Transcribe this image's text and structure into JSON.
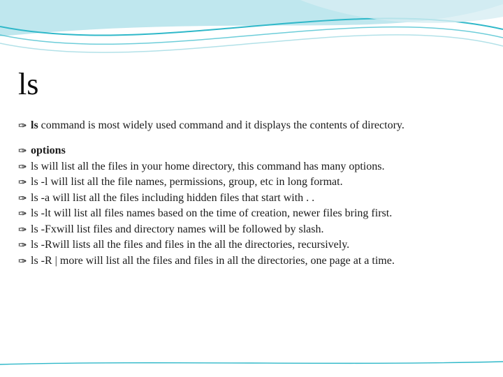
{
  "title": "ls",
  "intro": {
    "lead": "ls ",
    "rest": "command is most widely used command and it displays the contents of directory."
  },
  "options_heading": "options",
  "items": [
    "ls will list all the files in your home directory, this command has many options.",
    "ls -l will list all the file names, permissions, group, etc in long format.",
    "ls -a will list all the files including hidden files that start with . .",
    "ls -lt will list all files names based on the time of creation, newer files bring first.",
    "ls -Fxwill list files and directory names will be followed by slash.",
    "ls -Rwill lists all the files and files in the all the directories, recursively.",
    "ls -R | more will list all the files and files in all the directories, one page at a time."
  ]
}
